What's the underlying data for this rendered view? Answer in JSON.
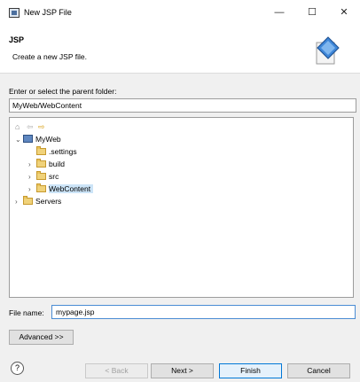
{
  "window": {
    "title": "New JSP File",
    "controls": {
      "minimize": "—",
      "maximize": "☐",
      "close": "✕"
    }
  },
  "header": {
    "title": "JSP",
    "description": "Create a new JSP file."
  },
  "parent_folder": {
    "label": "Enter or select the parent folder:",
    "value": "MyWeb/WebContent"
  },
  "tree": {
    "toolbar_icons": [
      "home-icon",
      "back-arrow-icon",
      "forward-arrow-icon"
    ],
    "items": [
      {
        "label": "MyWeb",
        "expanded": true
      },
      {
        "label": ".settings"
      },
      {
        "label": "build"
      },
      {
        "label": "src"
      },
      {
        "label": "WebContent",
        "selected": true
      },
      {
        "label": "Servers"
      }
    ]
  },
  "file_name": {
    "label": "File name:",
    "value": "mypage.jsp"
  },
  "buttons": {
    "advanced": "Advanced >>",
    "back": "< Back",
    "next": "Next >",
    "finish": "Finish",
    "cancel": "Cancel",
    "help": "?"
  },
  "colors": {
    "accent": "#0078d7",
    "selection": "#cce4f7",
    "dialog_bg": "#f0f0f0"
  }
}
